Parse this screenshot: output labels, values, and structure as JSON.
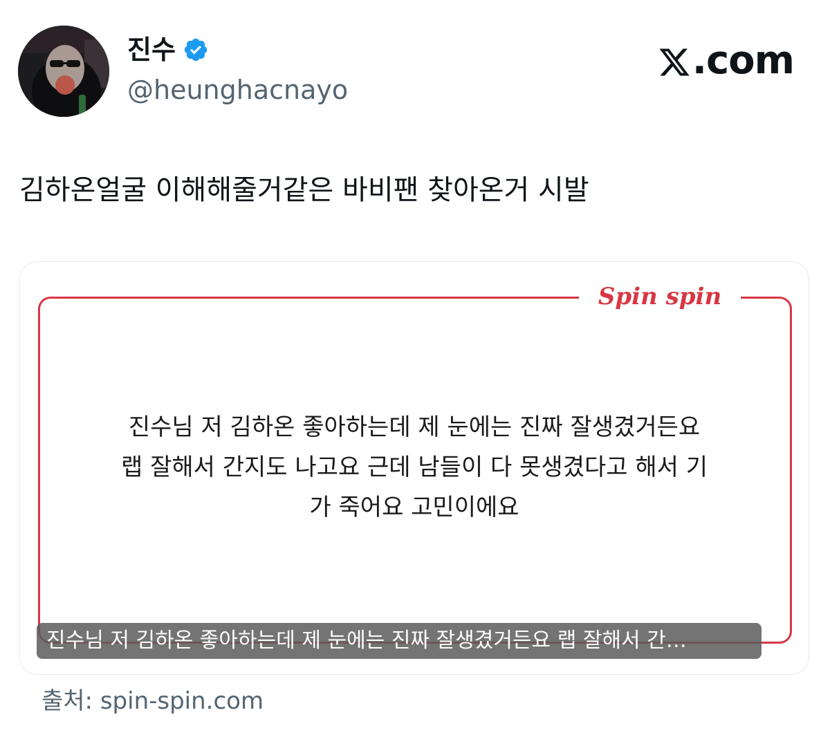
{
  "author": {
    "display_name": "진수",
    "handle": "@heunghacnayo"
  },
  "brand": {
    "logo_icon": "x-logo-icon",
    "suffix": ".com"
  },
  "tweet": {
    "text": "김하온얼굴 이해해줄거같은 바비팬 찾아온거 시발"
  },
  "card": {
    "site_logo": "Spin spin",
    "question_lines": [
      "진수님 저 김하온 좋아하는데 제 눈에는 진짜 잘생겼거든요",
      "랩 잘해서 간지도 나고요 근데 남들이 다 못생겼다고 해서 기",
      "가 죽어요 고민이에요"
    ],
    "caption": "진수님 저 김하온 좋아하는데 제 눈에는 진짜 잘생겼거든요 랩 잘해서 간…",
    "accent_color": "#d73744"
  },
  "source": {
    "text": "출처: spin-spin.com"
  },
  "colors": {
    "verified": "#1d9bf0",
    "secondary_text": "#536471"
  }
}
